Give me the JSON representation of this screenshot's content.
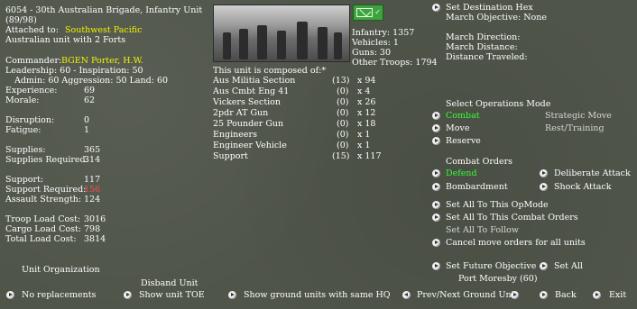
{
  "header": {
    "title": "6054 - 30th Australian  Brigade, Infantry Unit",
    "coords": "(89/98)",
    "attached_label": "Attached to:",
    "attached_value": "Southwest Pacific",
    "description": "Australian unit with 2 Forts"
  },
  "commander": {
    "label": "Commander:",
    "name": "BGEN Porter, H.W.",
    "leadership": "Leadership: 60 - Inspiration: 50",
    "admin": "Admin: 60  Aggression: 50  Land: 60"
  },
  "stats": {
    "experience_label": "Experience:",
    "experience": "69",
    "morale_label": "Morale:",
    "morale": "62",
    "disruption_label": "Disruption:",
    "disruption": "0",
    "fatigue_label": "Fatigue:",
    "fatigue": "1",
    "supplies_label": "Supplies:",
    "supplies": "365",
    "supplies_req_label": "Supplies Required:",
    "supplies_req": "314",
    "support_label": "Support:",
    "support": "117",
    "support_req_label": "Support Required:",
    "support_req": "156",
    "assault_label": "Assault Strength:",
    "assault": "124",
    "troop_load_label": "Troop Load Cost:",
    "troop_load": "3016",
    "cargo_load_label": "Cargo Load Cost:",
    "cargo_load": "798",
    "total_load_label": "Total Load Cost:",
    "total_load": "3814"
  },
  "counts": {
    "infantry": "Infantry: 1357",
    "vehicles": "Vehicles: 1",
    "guns": "Guns: 30",
    "other": "Other Troops: 1794"
  },
  "composition": {
    "heading": "This unit is composed of:*",
    "rows": [
      {
        "name": "Aus Militia Section",
        "damaged": "(13)",
        "count": "x  94"
      },
      {
        "name": "Aus Cmbt Eng 41",
        "damaged": "(0)",
        "count": "x   4"
      },
      {
        "name": "Vickers Section",
        "damaged": "(0)",
        "count": "x  26"
      },
      {
        "name": "2pdr AT Gun",
        "damaged": "(0)",
        "count": "x  12"
      },
      {
        "name": "25 Pounder Gun",
        "damaged": "(0)",
        "count": "x  18"
      },
      {
        "name": "Engineers",
        "damaged": "(0)",
        "count": "x   1"
      },
      {
        "name": "Engineer Vehicle",
        "damaged": "(0)",
        "count": "x   1"
      },
      {
        "name": "Support",
        "damaged": "(15)",
        "count": "x 117"
      }
    ]
  },
  "destination": {
    "set_label": "Set Destination Hex",
    "objective": "March Objective: None",
    "direction": "March Direction:",
    "distance": "March Distance:",
    "traveled": "Distance Traveled:"
  },
  "opmode": {
    "heading": "Select Operations Mode",
    "combat": "Combat",
    "strategic": "Strategic Move",
    "move": "Move",
    "rest": "Rest/Training",
    "reserve": "Reserve"
  },
  "combat_orders": {
    "heading": "Combat Orders",
    "defend": "Defend",
    "deliberate": "Deliberate Attack",
    "bombardment": "Bombardment",
    "shock": "Shock Attack"
  },
  "actions": {
    "set_all_opmode": "Set All To This OpMode",
    "set_all_combat": "Set All To This Combat Orders",
    "set_all_follow": "Set All To Follow",
    "cancel_move": "Cancel move orders for all units",
    "set_future": "Set Future Objective",
    "set_all": "Set All",
    "port": "Port Moresby (60)"
  },
  "footer": {
    "unit_org": "Unit Organization",
    "disband": "Disband Unit",
    "no_replacements": "No replacements",
    "show_toe": "Show unit TOE",
    "show_ground": "Show ground units with same HQ",
    "prev_next": "Prev/Next Ground Unit",
    "back": "Back",
    "exit": "Exit"
  },
  "colors": {
    "background": "#50554a",
    "highlight_yellow": "#f2f200",
    "selected_green": "#33ff33",
    "warning_red": "#ff4d4d"
  }
}
